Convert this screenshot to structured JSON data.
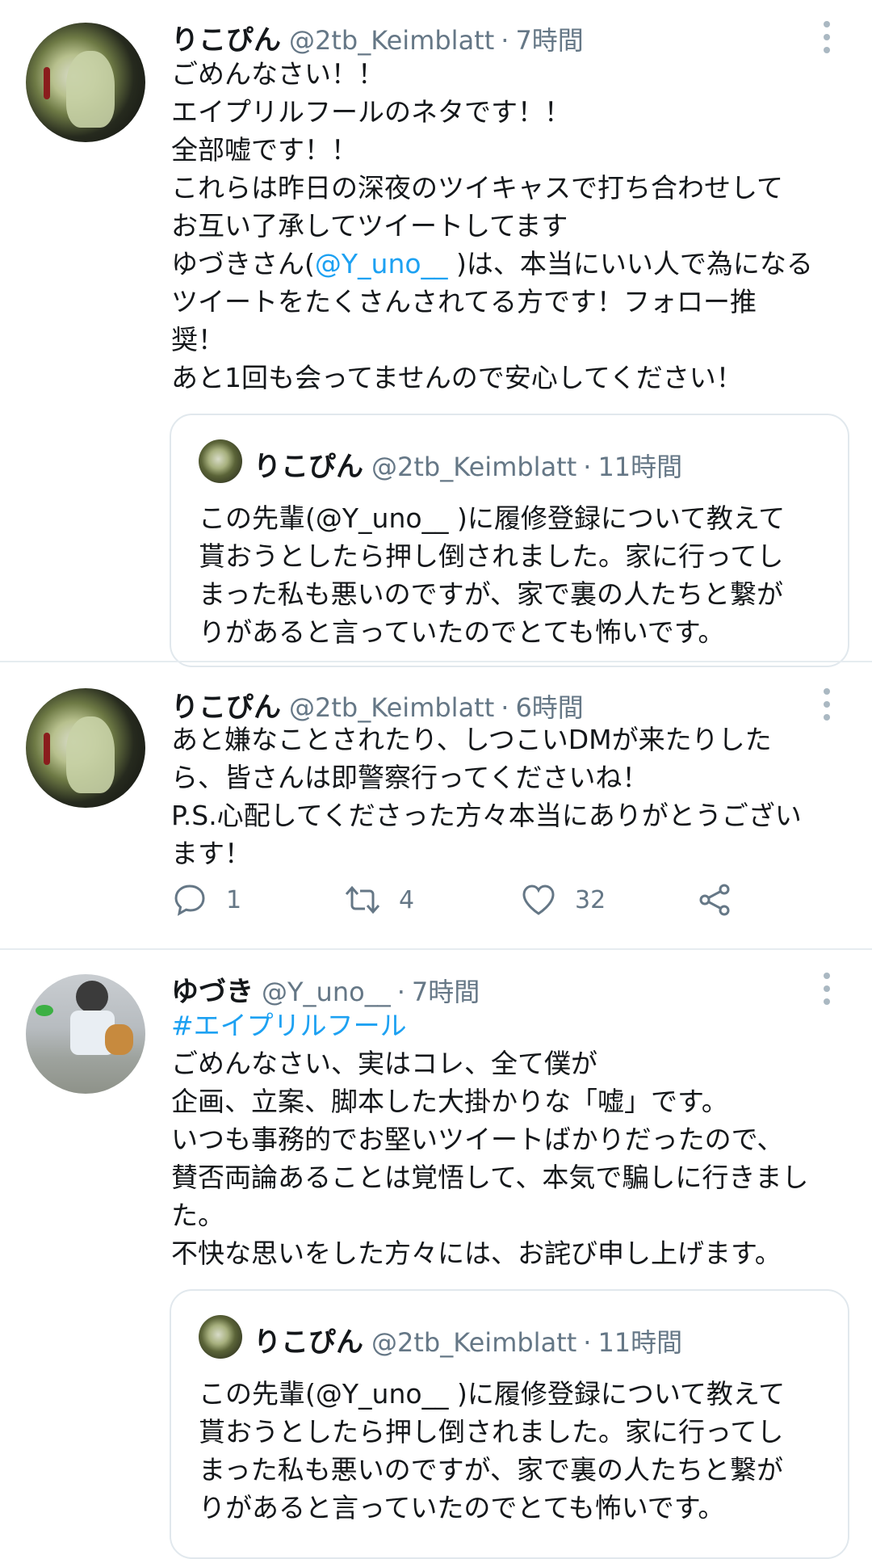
{
  "tweets": [
    {
      "name": "りこぴん",
      "handle": "@2tb_Keimblatt",
      "sep": "·",
      "time": "7時間",
      "line1": "ごめんなさい！！\nエイプリルフールのネタです！！\n全部嘘です！！\nこれらは昨日の深夜のツイキャスで打ち合わせして\nお互い了承してツイートしてます\nゆづきさん(",
      "mention": "@Y_uno__",
      "line2": " )は、本当にいい人で為になる\nツイートをたくさんされてる方です！フォロー推\n奨！\nあと1回も会ってませんので安心してください！",
      "quote": {
        "name": "りこぴん",
        "handle": "@2tb_Keimblatt",
        "sep": "·",
        "time": "11時間",
        "text": "この先輩(@Y_uno__ )に履修登録について教えて\n貰おうとしたら押し倒されました。家に行ってし\nまった私も悪いのですが、家で裏の人たちと繋が\nりがあると言っていたのでとても怖いです。"
      }
    },
    {
      "name": "りこぴん",
      "handle": "@2tb_Keimblatt",
      "sep": "·",
      "time": "6時間",
      "text": "あと嫌なことされたり、しつこいDMが来たりした\nら、皆さんは即警察行ってくださいね！\nP.S.心配してくださった方々本当にありがとうござい\nます！",
      "actions": {
        "replies": "1",
        "retweets": "4",
        "likes": "32"
      }
    },
    {
      "name": "ゆづき",
      "handle": "@Y_uno__",
      "sep": "·",
      "time": "7時間",
      "hashtag": "#エイプリルフール",
      "text": "ごめんなさい、実はコレ、全て僕が\n企画、立案、脚本した大掛かりな「嘘」です。\nいつも事務的でお堅いツイートばかりだったので、\n賛否両論あることは覚悟して、本気で騙しに行きまし\nた。\n不快な思いをした方々には、お詫び申し上げます。",
      "quote": {
        "name": "りこぴん",
        "handle": "@2tb_Keimblatt",
        "sep": "·",
        "time": "11時間",
        "text": "この先輩(@Y_uno__ )に履修登録について教えて\n貰おうとしたら押し倒されました。家に行ってし\nまった私も悪いのですが、家で裏の人たちと繋が\nりがあると言っていたのでとても怖いです。"
      }
    }
  ],
  "icons": [
    "more-icon",
    "reply-icon",
    "retweet-icon",
    "like-icon",
    "share-icon"
  ],
  "colors": {
    "link": "#1da1f2",
    "secondary": "#657786",
    "divider": "#e6ecf0"
  }
}
